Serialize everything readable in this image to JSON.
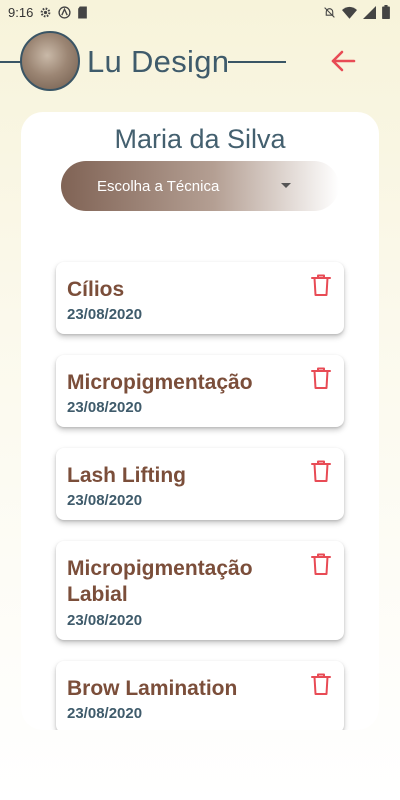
{
  "status_bar": {
    "time": "9:16",
    "icons_left": [
      "gear-icon",
      "a-icon",
      "sd-card-icon"
    ],
    "icons_right": [
      "mute-icon",
      "wifi-icon",
      "signal-icon",
      "battery-icon"
    ]
  },
  "header": {
    "brand": "Lu Design",
    "back_icon": "arrow-left-icon",
    "accent_color": "#e84b55"
  },
  "client": {
    "name": "Maria da Silva"
  },
  "technique_select": {
    "label": "Escolha a Técnica"
  },
  "procedures": [
    {
      "title": "Cílios",
      "date": "23/08/2020"
    },
    {
      "title": "Micropigmentação",
      "date": "23/08/2020"
    },
    {
      "title": "Lash Lifting",
      "date": "23/08/2020"
    },
    {
      "title": "Micropigmentação Labial",
      "date": "23/08/2020"
    },
    {
      "title": "Brow Lamination",
      "date": "23/08/2020"
    }
  ]
}
